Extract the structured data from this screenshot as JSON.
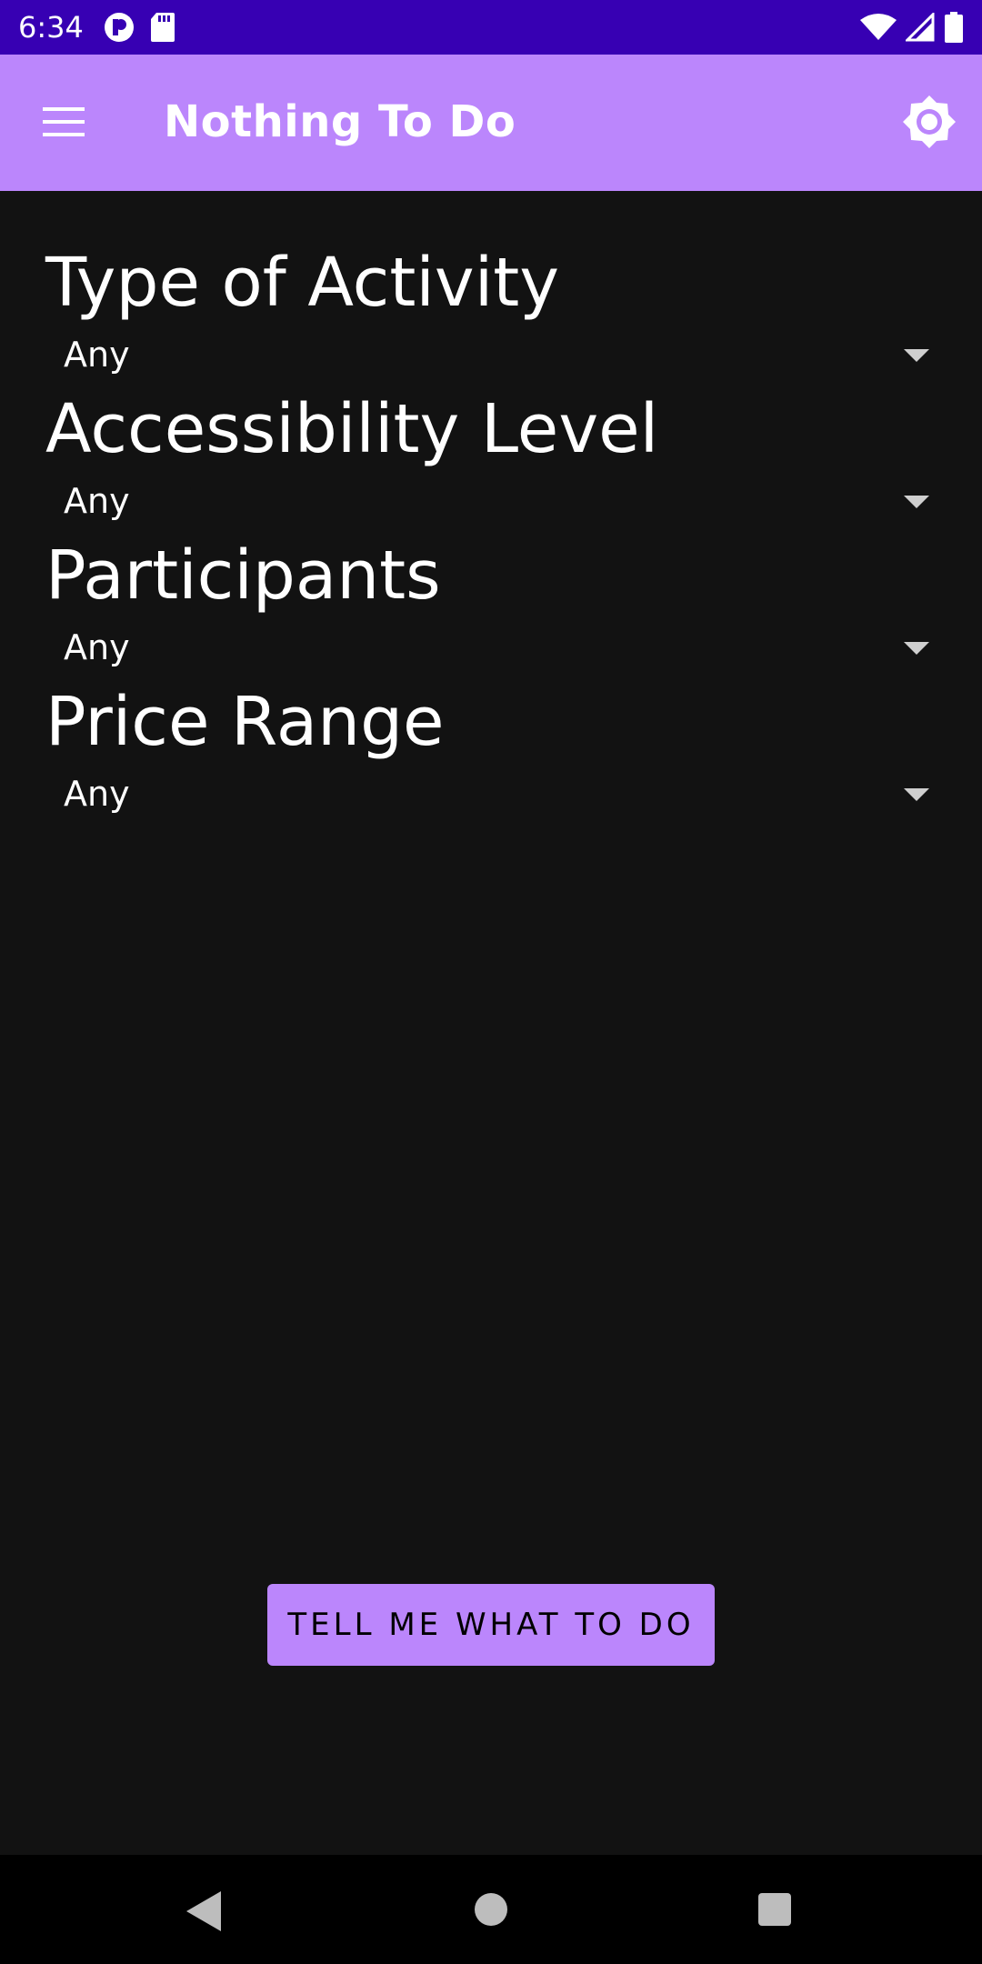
{
  "status_bar": {
    "time": "6:34",
    "left_icons": [
      "app-notification-icon",
      "sd-card-icon"
    ],
    "right_icons": [
      "wifi-icon",
      "cell-signal-icon",
      "battery-icon"
    ],
    "background": "#3700b3"
  },
  "app_bar": {
    "title": "Nothing To Do",
    "menu_icon": "hamburger-menu-icon",
    "theme_icon": "brightness-icon",
    "background": "#bb86fc"
  },
  "filters": [
    {
      "label": "Type of Activity",
      "value": "Any"
    },
    {
      "label": "Accessibility Level",
      "value": "Any"
    },
    {
      "label": "Participants",
      "value": "Any"
    },
    {
      "label": "Price Range",
      "value": "Any"
    }
  ],
  "action_button": {
    "label": "TELL ME WHAT TO DO",
    "background": "#bb86fc"
  },
  "nav_bar": {
    "icons": [
      "back-icon",
      "home-icon",
      "recents-icon"
    ]
  },
  "colors": {
    "background": "#121212",
    "accent": "#bb86fc",
    "status_bar": "#3700b3"
  }
}
